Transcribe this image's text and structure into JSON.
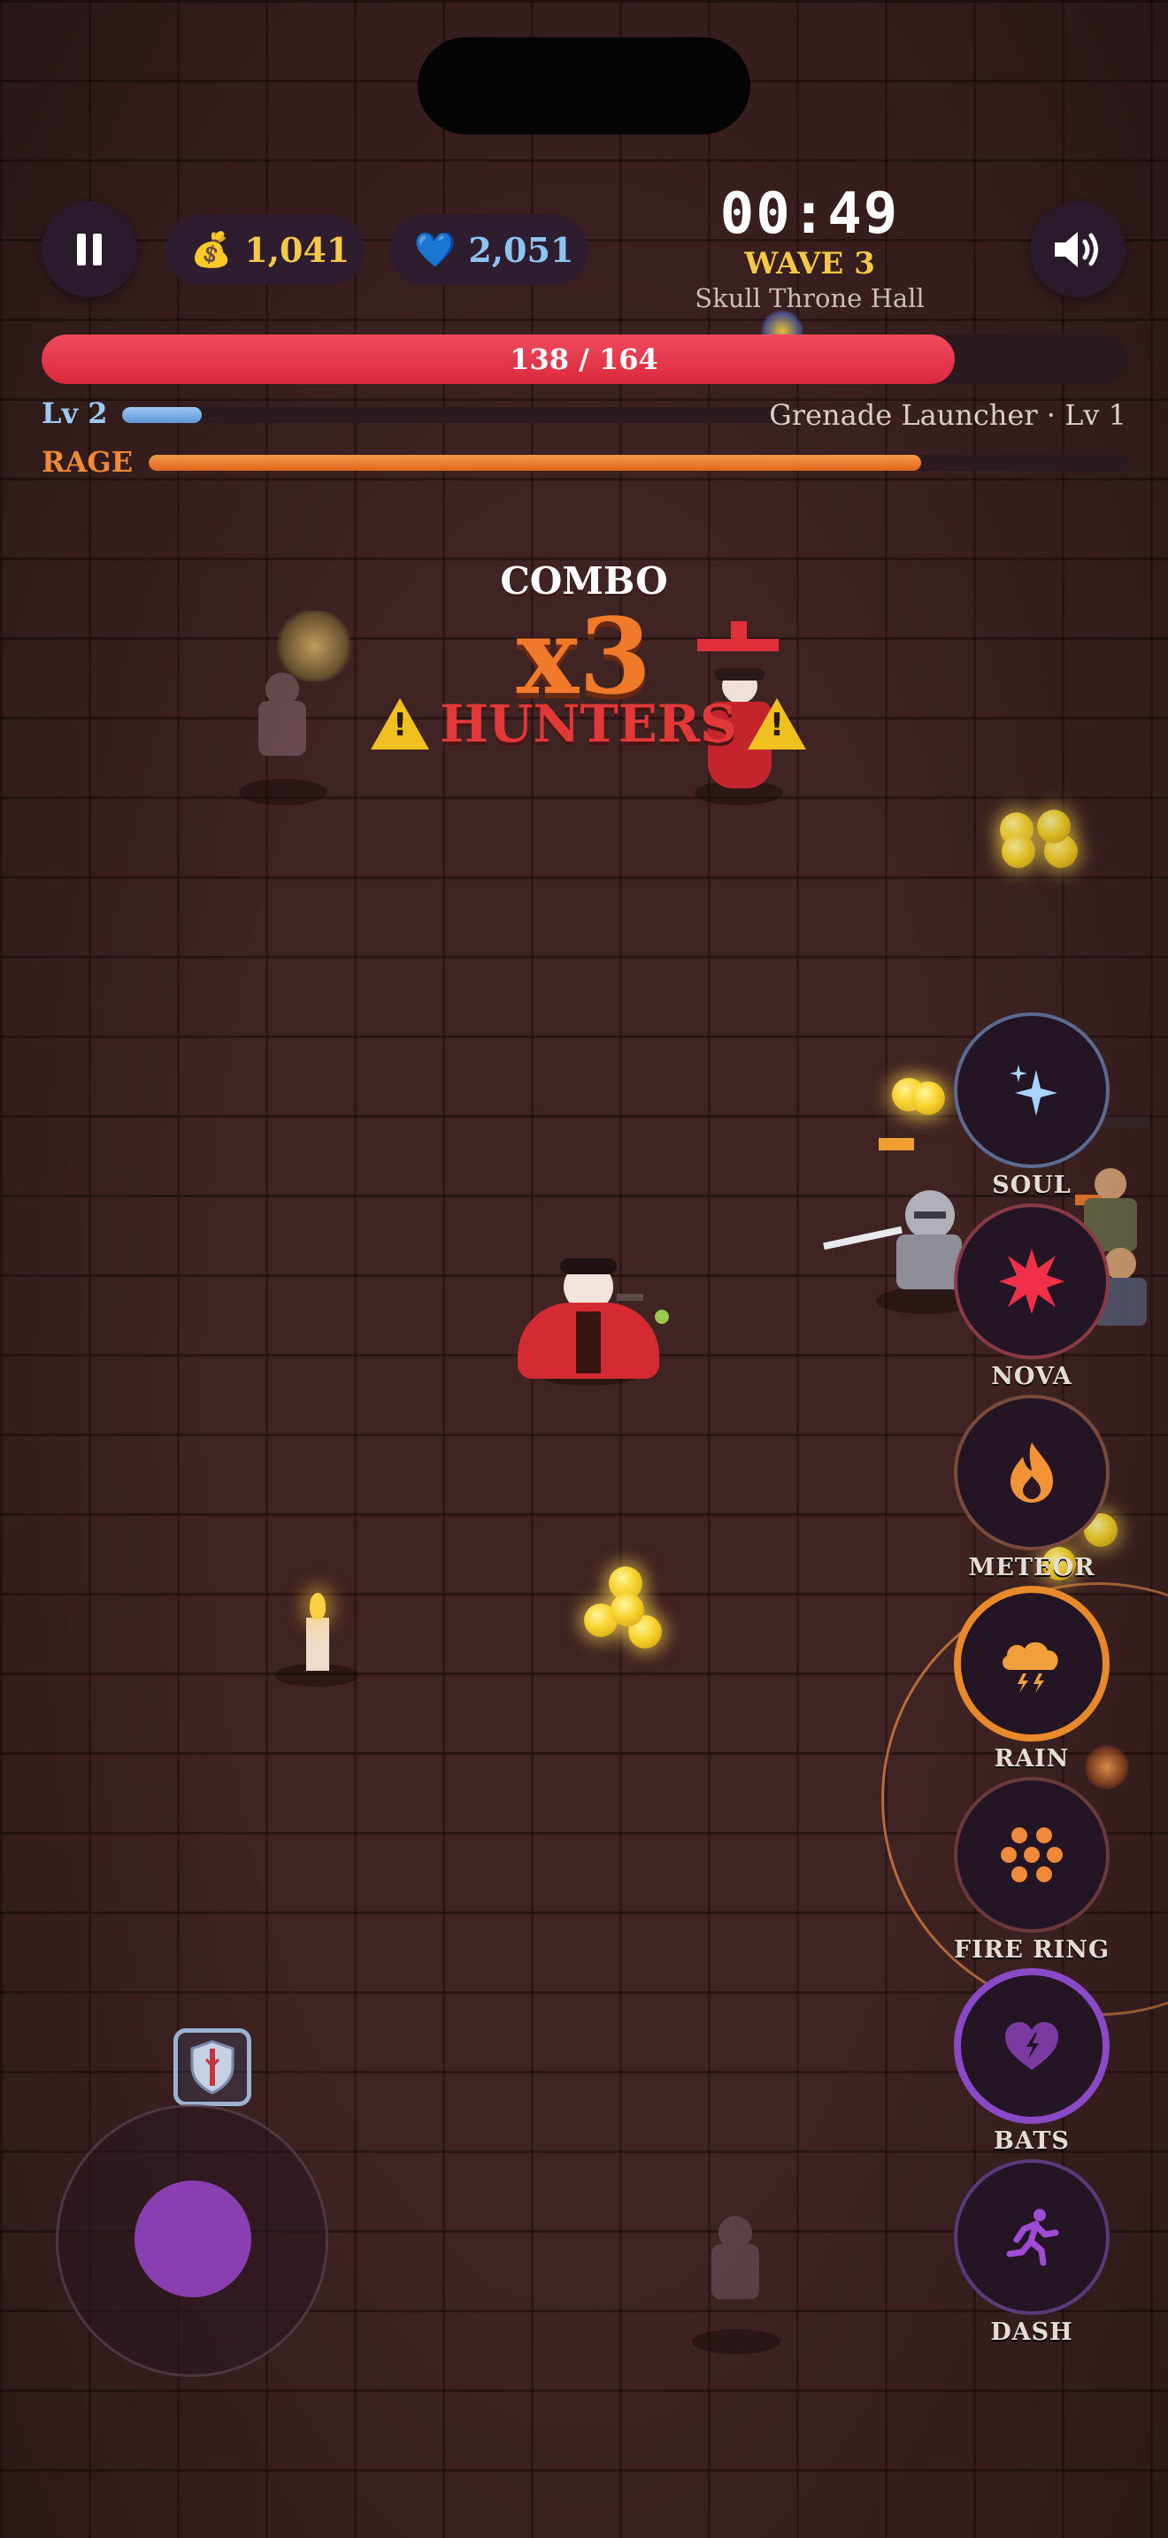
{
  "hud": {
    "gold": "1,041",
    "gems": "2,051",
    "timer": "00:49",
    "wave": "WAVE 3",
    "zone": "Skull Throne Hall",
    "hp_text": "138 / 164",
    "hp_current": 138,
    "hp_max": 164,
    "level": "Lv 2",
    "xp_fraction": 0.12,
    "weapon": "Grenade Launcher · Lv 1",
    "rage_label": "RAGE",
    "rage_fraction": 0.79
  },
  "combo": {
    "label": "COMBO",
    "multiplier": "x3",
    "alert": "HUNTERS"
  },
  "abilities": [
    {
      "label": "SOUL",
      "icon": "sparkle-icon"
    },
    {
      "label": "NOVA",
      "icon": "burst-icon"
    },
    {
      "label": "METEOR",
      "icon": "flame-icon"
    },
    {
      "label": "RAIN",
      "icon": "storm-cloud-icon"
    },
    {
      "label": "FIRE RING",
      "icon": "fire-ring-icon"
    },
    {
      "label": "BATS",
      "icon": "bat-heart-icon"
    },
    {
      "label": "DASH",
      "icon": "running-person-icon"
    }
  ],
  "colors": {
    "hp": "#e3364a",
    "xp": "#7fb2e6",
    "rage": "#ec7b2f",
    "wave": "#f6c84a",
    "combo": "#f07a2a",
    "alert": "#e23838"
  }
}
